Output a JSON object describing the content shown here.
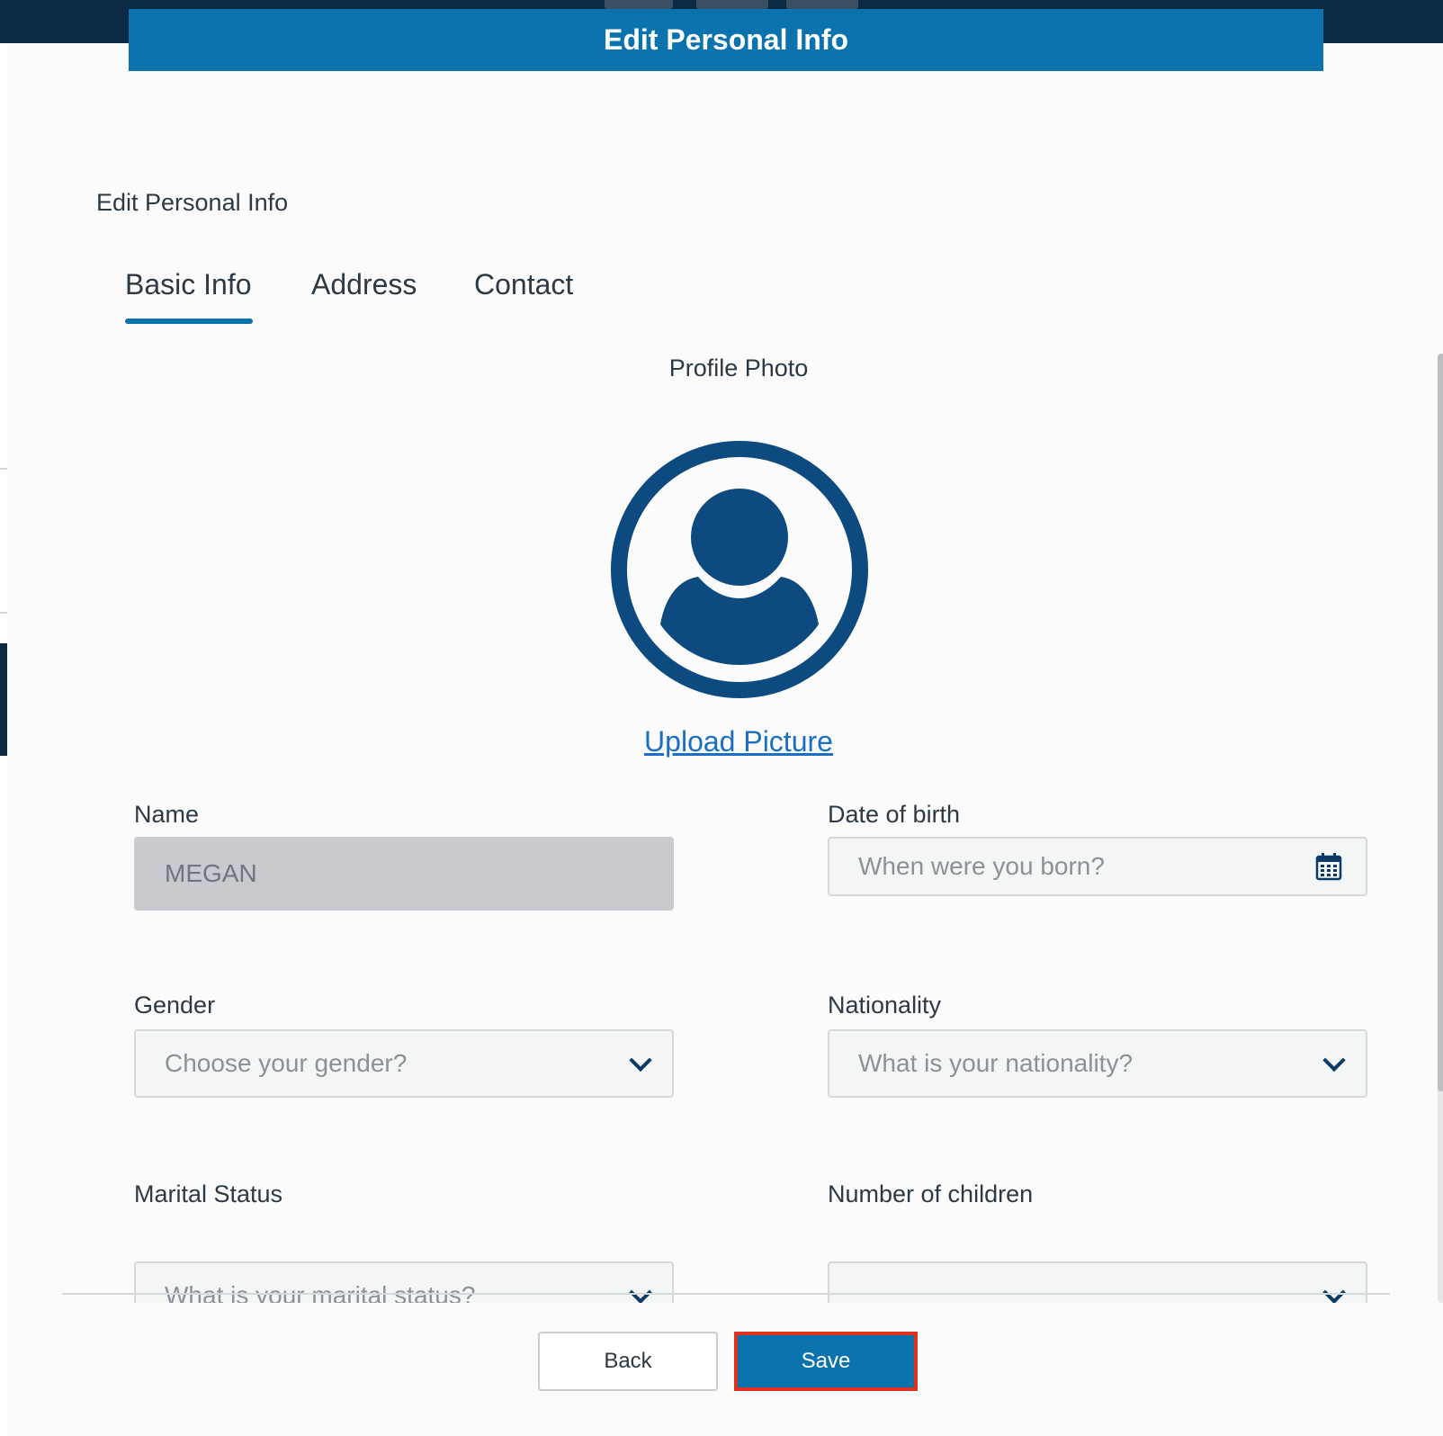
{
  "header": {
    "title": "Edit Personal Info"
  },
  "section": {
    "title": "Edit Personal Info"
  },
  "tabs": [
    {
      "label": "Basic Info",
      "active": true
    },
    {
      "label": "Address",
      "active": false
    },
    {
      "label": "Contact",
      "active": false
    }
  ],
  "profile": {
    "label": "Profile Photo",
    "upload_label": "Upload Picture",
    "icon": "user-avatar-icon"
  },
  "fields": {
    "name": {
      "label": "Name",
      "value": "MEGAN"
    },
    "dob": {
      "label": "Date of birth",
      "placeholder": "When were you born?",
      "icon": "calendar-icon"
    },
    "gender": {
      "label": "Gender",
      "placeholder": "Choose your gender?"
    },
    "nationality": {
      "label": "Nationality",
      "placeholder": "What is your nationality?"
    },
    "marital": {
      "label": "Marital Status",
      "placeholder": "What is your marital status?"
    },
    "children": {
      "label": "Number of children",
      "value": ""
    }
  },
  "buttons": {
    "back": "Back",
    "save": "Save"
  },
  "colors": {
    "primary": "#0a72ac",
    "dark_nav": "#0d2a45",
    "avatar": "#0d4a7f",
    "link": "#1a6fc4",
    "highlight_border": "#e0321c"
  }
}
